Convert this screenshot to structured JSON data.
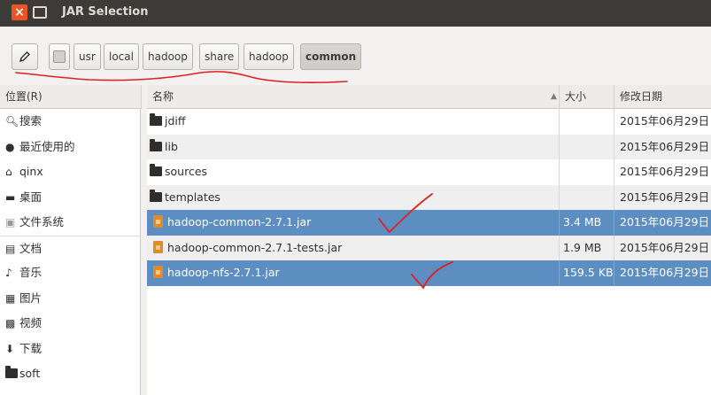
{
  "window": {
    "title": "JAR Selection"
  },
  "pathbar": {
    "crumbs": [
      "usr",
      "local",
      "hadoop",
      "share",
      "hadoop",
      "common"
    ],
    "active_index": 5
  },
  "columns": {
    "places": "位置(R)",
    "name": "名称",
    "size": "大小",
    "date": "修改日期"
  },
  "places": [
    {
      "icon": "search-icon",
      "label": "搜索"
    },
    {
      "icon": "recent-icon",
      "label": "最近使用的"
    },
    {
      "icon": "home-icon",
      "label": "qinx"
    },
    {
      "icon": "desktop-icon",
      "label": "桌面"
    },
    {
      "icon": "drive-icon",
      "label": "文件系统"
    },
    {
      "icon": "documents-icon",
      "label": "文档"
    },
    {
      "icon": "music-icon",
      "label": "音乐"
    },
    {
      "icon": "pictures-icon",
      "label": "图片"
    },
    {
      "icon": "video-icon",
      "label": "视频"
    },
    {
      "icon": "download-icon",
      "label": "下载"
    },
    {
      "icon": "folder-icon",
      "label": "soft"
    }
  ],
  "files": [
    {
      "type": "folder",
      "name": "jdiff",
      "size": "",
      "date": "2015年06月29日"
    },
    {
      "type": "folder",
      "name": "lib",
      "size": "",
      "date": "2015年06月29日"
    },
    {
      "type": "folder",
      "name": "sources",
      "size": "",
      "date": "2015年06月29日"
    },
    {
      "type": "folder",
      "name": "templates",
      "size": "",
      "date": "2015年06月29日"
    },
    {
      "type": "jar",
      "name": "hadoop-common-2.7.1.jar",
      "size": "3.4 MB",
      "date": "2015年06月29日",
      "selected": true
    },
    {
      "type": "jar",
      "name": "hadoop-common-2.7.1-tests.jar",
      "size": "1.9 MB",
      "date": "2015年06月29日"
    },
    {
      "type": "jar",
      "name": "hadoop-nfs-2.7.1.jar",
      "size": "159.5 KB",
      "date": "2015年06月29日",
      "selected": true
    }
  ],
  "colors": {
    "selection": "#5c8ec1",
    "titlebar": "#3c3b37",
    "close": "#e95420",
    "annotation": "#e02020"
  }
}
